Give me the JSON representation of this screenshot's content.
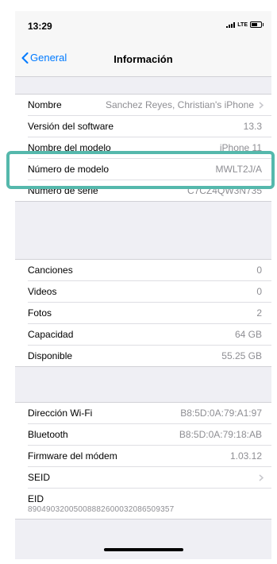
{
  "status": {
    "time": "13:29",
    "carrier": "LTE"
  },
  "nav": {
    "back_label": "General",
    "title": "Información"
  },
  "group1": [
    {
      "label": "Nombre",
      "value": "Sanchez Reyes, Christian's iPhone",
      "chevron": true
    },
    {
      "label": "Versión del software",
      "value": "13.3"
    },
    {
      "label": "Nombre del modelo",
      "value": "iPhone 11"
    },
    {
      "label": "Número de modelo",
      "value": "MWLT2J/A"
    },
    {
      "label": "Número de serie",
      "value": "C7CZ4QW3N735"
    }
  ],
  "group2": [
    {
      "label": "Canciones",
      "value": "0"
    },
    {
      "label": "Videos",
      "value": "0"
    },
    {
      "label": "Fotos",
      "value": "2"
    },
    {
      "label": "Capacidad",
      "value": "64 GB"
    },
    {
      "label": "Disponible",
      "value": "55.25 GB"
    }
  ],
  "group3": [
    {
      "label": "Dirección Wi-Fi",
      "value": "B8:5D:0A:79:A1:97"
    },
    {
      "label": "Bluetooth",
      "value": "B8:5D:0A:79:18:AB"
    },
    {
      "label": "Firmware del módem",
      "value": "1.03.12"
    },
    {
      "label": "SEID",
      "value": "",
      "chevron": true
    },
    {
      "label": "EID",
      "sub": "89049032005008882600032086509357"
    }
  ],
  "colors": {
    "highlight": "#55b8ac",
    "link": "#007aff"
  }
}
